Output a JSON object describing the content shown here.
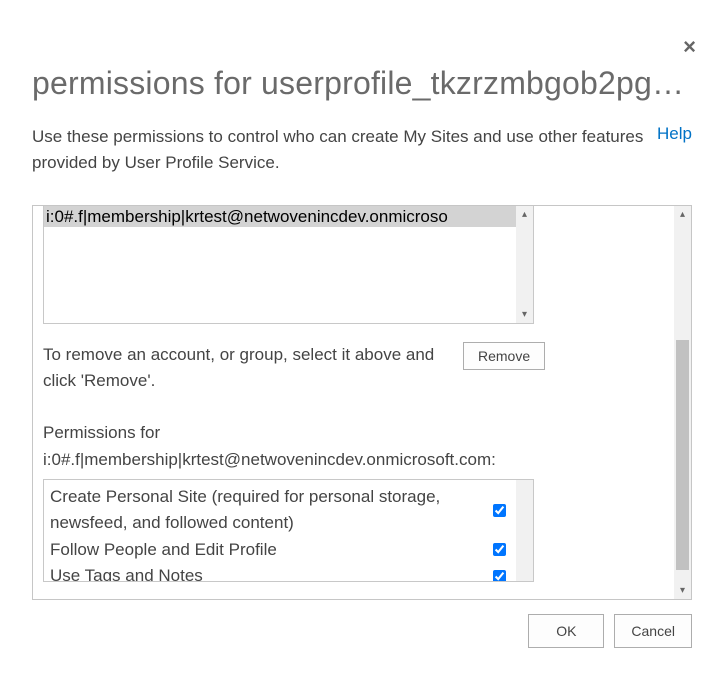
{
  "dialog": {
    "title": "permissions for userprofile_tkzrzmbgob2pg…",
    "description": "Use these permissions to control who can create My Sites and use other features provided by User Profile Service.",
    "help_label": "Help",
    "close_label": "×"
  },
  "listbox": {
    "selected_text": "i:0#.f|membership|krtest@netwovenincdev.onmicroso"
  },
  "remove_section": {
    "text": "To remove an account, or group, select it above and click 'Remove'.",
    "button_label": "Remove"
  },
  "permissions_for": {
    "prefix": "Permissions for",
    "subject": "i:0#.f|membership|krtest@netwovenincdev.onmicrosoft.com:"
  },
  "permissions": [
    {
      "label": "Create Personal Site (required for personal storage, newsfeed, and followed content)",
      "checked": true
    },
    {
      "label": "Follow People and Edit Profile",
      "checked": true
    },
    {
      "label": "Use Tags and Notes",
      "checked": true
    }
  ],
  "footer": {
    "ok_label": "OK",
    "cancel_label": "Cancel"
  }
}
